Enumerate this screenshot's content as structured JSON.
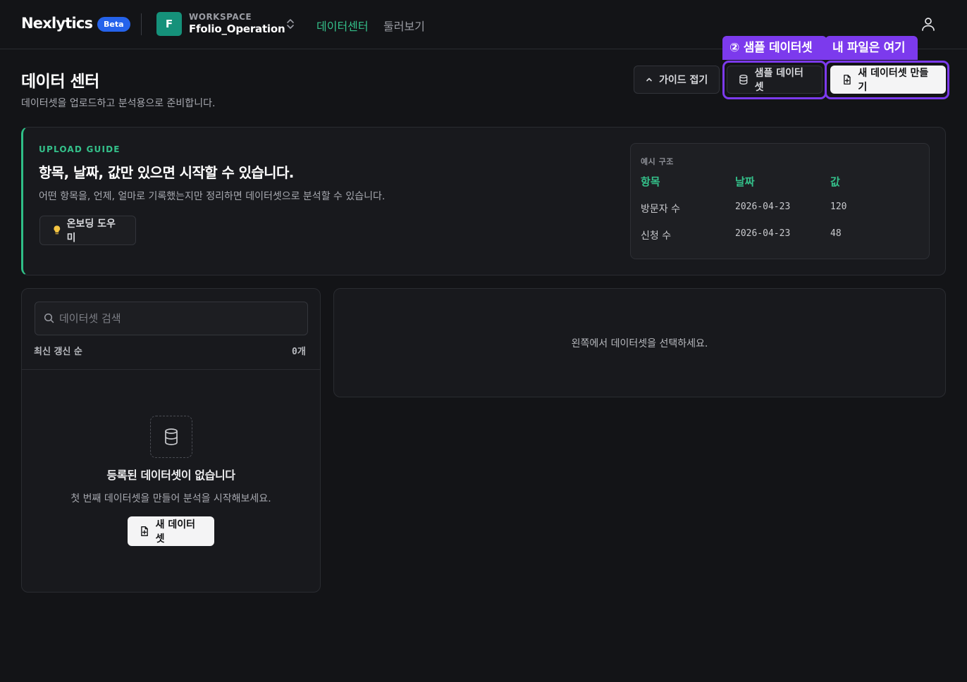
{
  "app": {
    "brand": "Nexlytics",
    "beta_badge": "Beta",
    "workspace": {
      "kicker": "WORKSPACE",
      "initial": "F",
      "name": "Ffolio_Operation"
    },
    "nav": {
      "data_center": "데이터센터",
      "browse": "둘러보기"
    },
    "accent_color": "#34c08a",
    "highlight_color": "#7c3aed"
  },
  "header": {
    "title": "데이터 센터",
    "subtitle": "데이터셋을 업로드하고 분석용으로 준비합니다.",
    "buttons": {
      "guide_toggle": "가이드 접기",
      "sample_dataset": "샘플 데이터셋",
      "new_dataset": "새 데이터셋 만들기"
    },
    "tooltips": {
      "sample": "② 샘플 데이터셋",
      "new": "내 파일은 여기"
    }
  },
  "guide": {
    "kicker": "UPLOAD GUIDE",
    "title": "항목, 날짜, 값만 있으면 시작할 수 있습니다.",
    "description": "어떤 항목을, 언제, 얼마로 기록했는지만 정리하면 데이터셋으로 분석할 수 있습니다.",
    "onboarding_button": "온보딩 도우미",
    "example": {
      "label": "예시 구조",
      "headers": [
        "항목",
        "날짜",
        "값"
      ],
      "rows": [
        [
          "방문자 수",
          "2026-04-23",
          "120"
        ],
        [
          "신청 수",
          "2026-04-23",
          "48"
        ]
      ]
    }
  },
  "dataset_list": {
    "search_placeholder": "데이터셋 검색",
    "sort_label": "최신 갱신 순",
    "count_label": "0개",
    "empty_title": "등록된 데이터셋이 없습니다",
    "empty_description": "첫 번째 데이터셋을 만들어 분석을 시작해보세요.",
    "empty_button": "새 데이터셋"
  },
  "detail": {
    "empty_message": "왼쪽에서 데이터셋을 선택하세요."
  }
}
